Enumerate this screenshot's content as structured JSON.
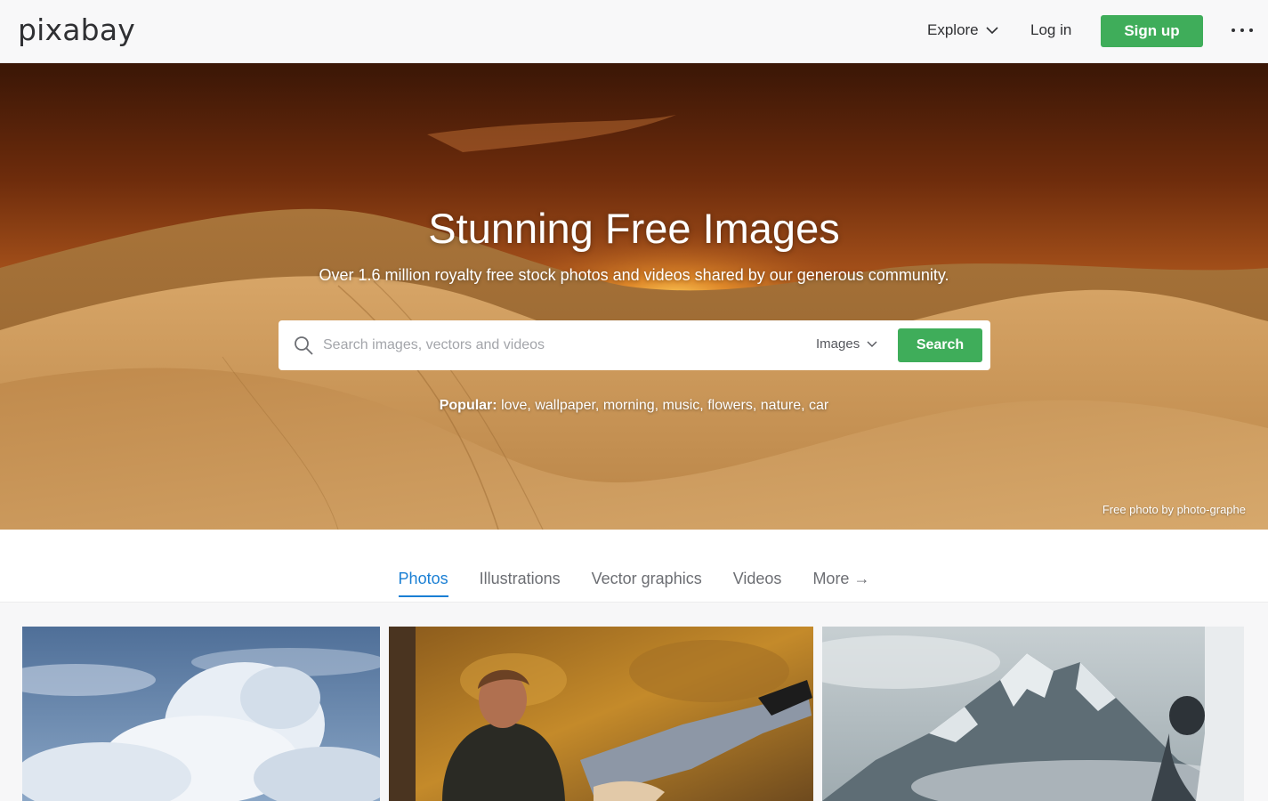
{
  "header": {
    "logo": "pixabay",
    "explore_label": "Explore",
    "login_label": "Log in",
    "signup_label": "Sign up"
  },
  "hero": {
    "title": "Stunning Free Images",
    "subtitle": "Over 1.6 million royalty free stock photos and videos shared by our generous community.",
    "search": {
      "placeholder": "Search images, vectors and videos",
      "value": "",
      "type_selected": "Images",
      "button_label": "Search"
    },
    "popular": {
      "label": "Popular:",
      "tags": [
        "love",
        "wallpaper",
        "morning",
        "music",
        "flowers",
        "nature",
        "car"
      ]
    },
    "credit": "Free photo by photo-graphe"
  },
  "tabs": [
    {
      "label": "Photos",
      "active": true
    },
    {
      "label": "Illustrations",
      "active": false
    },
    {
      "label": "Vector graphics",
      "active": false
    },
    {
      "label": "Videos",
      "active": false
    },
    {
      "label": "More →",
      "active": false
    }
  ],
  "colors": {
    "accent_green": "#3fad5a",
    "tab_active_blue": "#1a7fd4"
  }
}
